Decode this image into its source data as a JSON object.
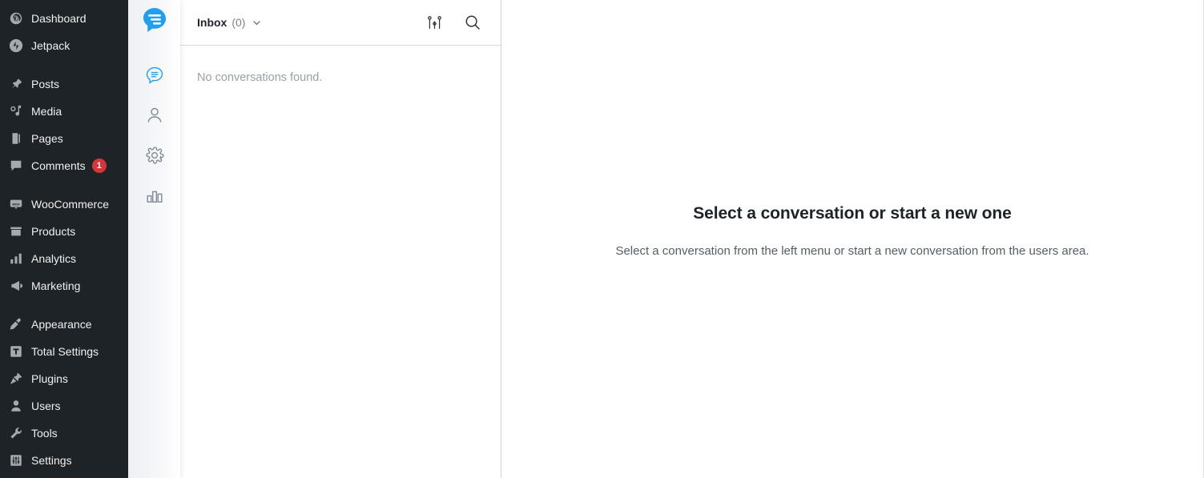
{
  "wp_sidebar": {
    "groups": [
      {
        "items": [
          {
            "label": "Dashboard",
            "icon": "dashboard-icon",
            "badge": null
          },
          {
            "label": "Jetpack",
            "icon": "jetpack-icon",
            "badge": null
          }
        ]
      },
      {
        "items": [
          {
            "label": "Posts",
            "icon": "pin-icon",
            "badge": null
          },
          {
            "label": "Media",
            "icon": "media-icon",
            "badge": null
          },
          {
            "label": "Pages",
            "icon": "pages-icon",
            "badge": null
          },
          {
            "label": "Comments",
            "icon": "comments-icon",
            "badge": "1"
          }
        ]
      },
      {
        "items": [
          {
            "label": "WooCommerce",
            "icon": "woocommerce-icon",
            "badge": null
          },
          {
            "label": "Products",
            "icon": "products-icon",
            "badge": null
          },
          {
            "label": "Analytics",
            "icon": "analytics-icon",
            "badge": null
          },
          {
            "label": "Marketing",
            "icon": "marketing-icon",
            "badge": null
          }
        ]
      },
      {
        "items": [
          {
            "label": "Appearance",
            "icon": "appearance-icon",
            "badge": null
          },
          {
            "label": "Total Settings",
            "icon": "total-settings-icon",
            "badge": null
          },
          {
            "label": "Plugins",
            "icon": "plugins-icon",
            "badge": null
          },
          {
            "label": "Users",
            "icon": "users-icon",
            "badge": null
          },
          {
            "label": "Tools",
            "icon": "tools-icon",
            "badge": null
          },
          {
            "label": "Settings",
            "icon": "settings-icon",
            "badge": null
          }
        ]
      }
    ]
  },
  "rail": {
    "logo_icon": "chat-logo-icon",
    "items": [
      {
        "icon": "conversations-icon",
        "active": true
      },
      {
        "icon": "user-icon",
        "active": false
      },
      {
        "icon": "gear-icon",
        "active": false
      },
      {
        "icon": "bar-chart-icon",
        "active": false
      }
    ]
  },
  "conversation_list": {
    "header": {
      "title": "Inbox",
      "count": "(0)",
      "chevron_icon": "chevron-down-icon",
      "filter_icon": "sliders-icon",
      "search_icon": "search-icon"
    },
    "empty_text": "No conversations found."
  },
  "main": {
    "title": "Select a conversation or start a new one",
    "subtitle": "Select a conversation from the left menu or start a new conversation from the users area."
  },
  "colors": {
    "brand_blue": "#1e9ff2",
    "sidebar_bg": "#1d2327",
    "badge_red": "#d63638"
  }
}
